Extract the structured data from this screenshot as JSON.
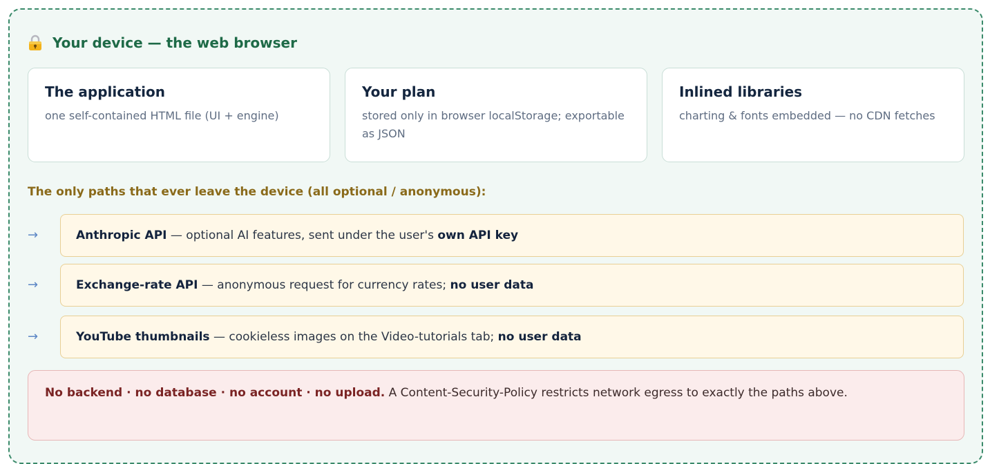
{
  "header": {
    "title": "Your device — the web browser",
    "icon": "lock-icon"
  },
  "cards": [
    {
      "title": "The application",
      "desc": "one self-contained HTML file (UI + engine)"
    },
    {
      "title": "Your plan",
      "desc": "stored only in browser localStorage; exportable as JSON"
    },
    {
      "title": "Inlined libraries",
      "desc": "charting & fonts embedded — no CDN fetches"
    }
  ],
  "egress": {
    "label": "The only paths that ever leave the device (all optional / anonymous):",
    "arrow": "→",
    "paths": [
      {
        "name": "Anthropic API",
        "desc": " — optional AI features, sent under the user's ",
        "emphasis": "own API key"
      },
      {
        "name": "Exchange-rate API",
        "desc": " — anonymous request for currency rates; ",
        "emphasis": "no user data"
      },
      {
        "name": "YouTube thumbnails",
        "desc": " — cookieless images on the Video-tutorials tab; ",
        "emphasis": "no user data"
      }
    ]
  },
  "note": {
    "bold": "No backend · no database · no account · no upload.",
    "text": " A Content-Security-Policy restricts network egress to exactly the paths above."
  },
  "colors": {
    "frame_border": "#3a8a6a",
    "header_text": "#1e6a47",
    "egress_label": "#8a6a1a",
    "path_bg": "#fff8e8",
    "note_bg": "#fbecec",
    "arrow": "#5b86c5"
  }
}
